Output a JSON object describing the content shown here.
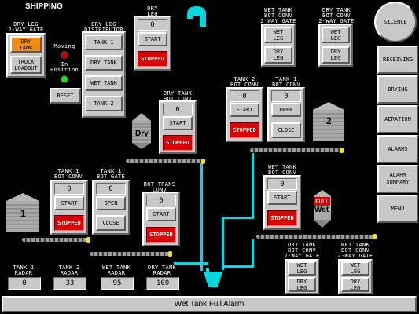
{
  "header": {
    "title": "SHIPPING"
  },
  "dry_leg_gate": {
    "label": "DRY LEG\n2-WAY GATE",
    "dry_tank": "DRY\nTANK",
    "truck_loadout": "TRUCK\nLOADOUT"
  },
  "distributor": {
    "label": "DRY LEG\nDISTRIBUTOR",
    "moving": "Moving",
    "in_position": "In\nPosition",
    "reset": "RESET",
    "tank1": "TANK 1",
    "dry_tank": "DRY TANK",
    "wet_tank": "WET TANK",
    "tank2": "TANK 2"
  },
  "dry_leg": {
    "label": "DRY\nLEG",
    "value": "0",
    "start": "START",
    "status": "STOPPED"
  },
  "dry_tank_bot_conv": {
    "label": "DRY TANK\nBOT CONV",
    "value": "0",
    "start": "START",
    "status": "STOPPED"
  },
  "tank1_bot_conv": {
    "label": "TANK 1\nBOT CONV",
    "value": "0",
    "start": "START",
    "status": "STOPPED"
  },
  "tank1_bot_gate": {
    "label": "TANK 1\nBOT GATE",
    "value": "0",
    "open": "OPEN",
    "close": "CLOSE"
  },
  "bot_trans_conv": {
    "label": "BOT TRANS\nCONV",
    "value": "0",
    "start": "START",
    "status": "STOPPED"
  },
  "tank2_bot_conv": {
    "label": "TANK 2\nBOT CONV",
    "value": "0",
    "start": "START",
    "status": "STOPPED"
  },
  "tank1_bot_conv_b": {
    "label": "TANK 1\nBOT CONV",
    "value": "0",
    "open": "OPEN",
    "close": "CLOSE"
  },
  "wet_tank_bot_conv": {
    "label": "WET TANK\nBOT CONV",
    "value": "0",
    "start": "START",
    "status": "STOPPED"
  },
  "wet_tank_gate_top1": {
    "label": "WET TANK\nBOT CONV\n2-WAY GATE",
    "a": "WET\nLEG",
    "b": "DRY\nLEG"
  },
  "wet_tank_gate_top2": {
    "label": "DRY TANK\nBOT CONV\n2-WAY GATE",
    "a": "WET\nLEG",
    "b": "DRY\nLEG"
  },
  "gate_bottom1": {
    "label": "DRY TANK\nBOT CONV\n2-WAY GATE",
    "a": "WET\nLEG",
    "b": "DRY\nLEG"
  },
  "gate_bottom2": {
    "label": "WET TANK\nBOT CONV\n2-WAY GATE",
    "a": "WET\nLEG",
    "b": "DRY\nLEG"
  },
  "bins": {
    "dry": "Dry",
    "tank1": "1",
    "tank2": "2",
    "wet_full": "FULL",
    "wet": "Wet"
  },
  "radar": [
    {
      "label": "TANK 1\nRADAR",
      "value": "0"
    },
    {
      "label": "TANK 2\nRADAR",
      "value": "33"
    },
    {
      "label": "WET TANK\nRADAR",
      "value": "95"
    },
    {
      "label": "DRY TANK\nRADAR",
      "value": "100"
    }
  ],
  "nav": {
    "silence": "SILENCE",
    "receiving": "RECEIVING",
    "drying": "DRYING",
    "aeration": "AERATION",
    "alarms": "ALARMS",
    "alarm_summary": "ALARM\nSUMMARY",
    "menu": "MENU"
  },
  "status": {
    "message": "Wet Tank Full Alarm"
  },
  "colors": {
    "pipe": "#00d8e0",
    "stopped": "#d80000",
    "dry_tank_selected": "#f08c10",
    "lamp_red": "#c00000",
    "lamp_green": "#20e020"
  }
}
